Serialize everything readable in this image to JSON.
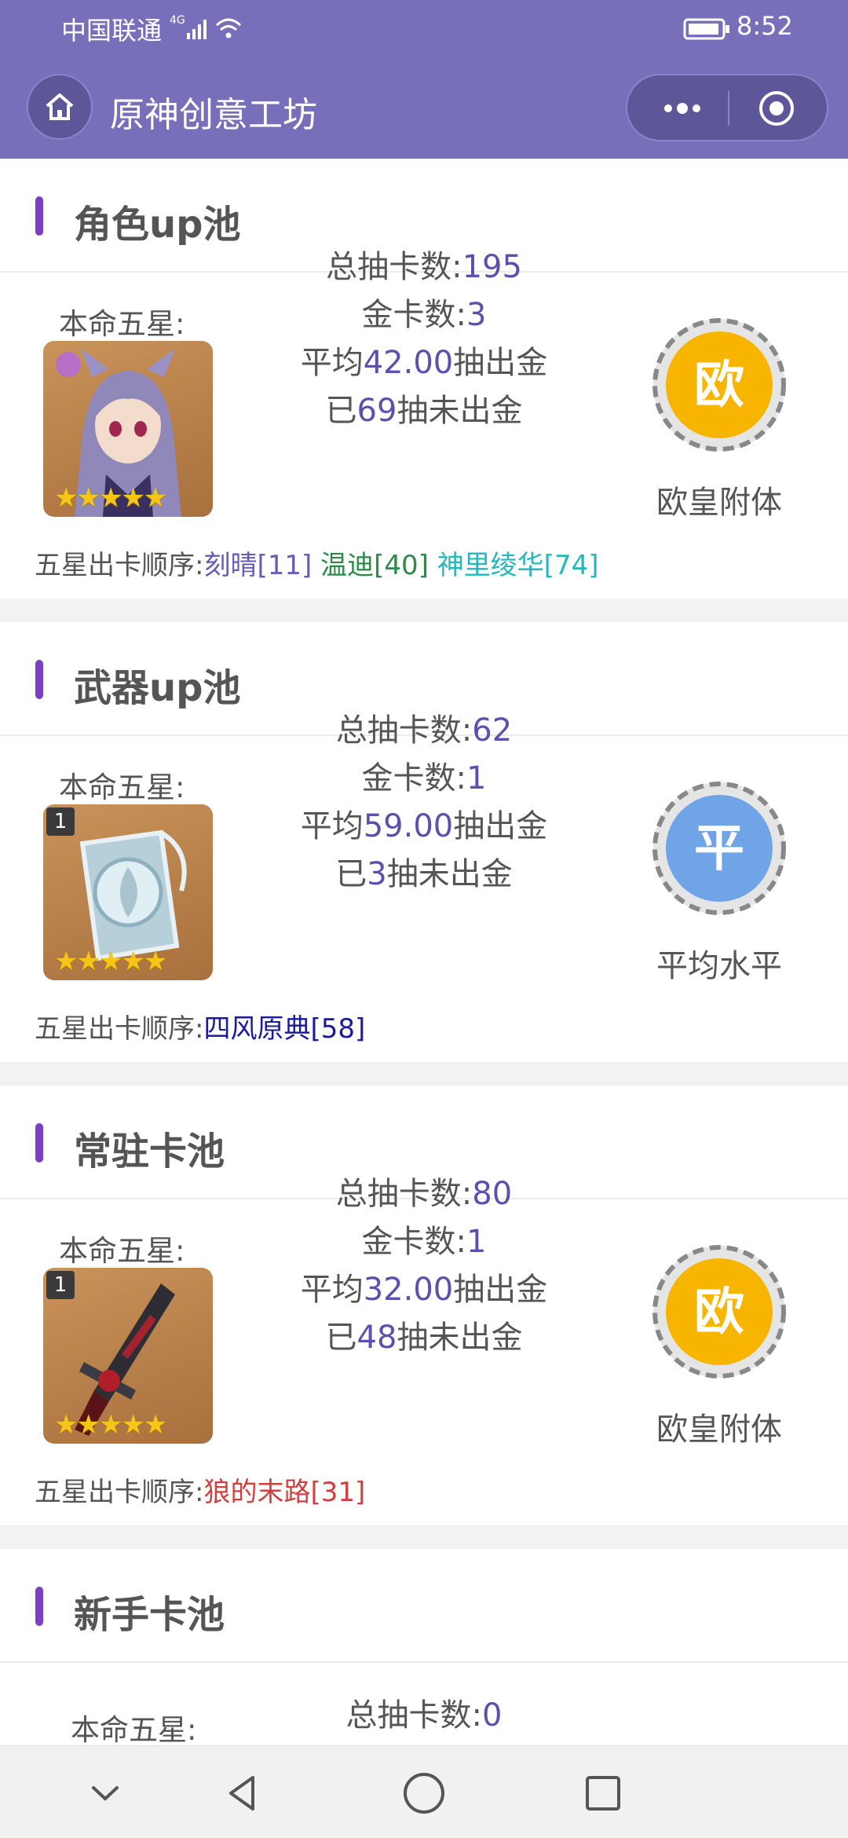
{
  "status_bar": {
    "carrier": "中国联通",
    "network": "4G",
    "time": "8:52"
  },
  "header": {
    "title": "原神创意工坊"
  },
  "common": {
    "main_label": "本命五星:",
    "order_label": "五星出卡顺序:"
  },
  "pools": [
    {
      "title": "角色up池",
      "total_label": "总抽卡数:",
      "total": "195",
      "gold_label": "金卡数:",
      "gold": "3",
      "avg_prefix": "平均",
      "avg": "42.00",
      "avg_suffix": "抽出金",
      "since_prefix": "已",
      "since": "69",
      "since_suffix": "抽未出金",
      "badge_char": "欧",
      "badge_label": "欧皇附体",
      "badge_color": "#f7b500",
      "order": [
        {
          "name": "刻晴[11]",
          "color": "#6a5ab8"
        },
        {
          "name": "温迪[40]",
          "color": "#2f8a4a"
        },
        {
          "name": "神里绫华[74]",
          "color": "#22b8bd"
        }
      ]
    },
    {
      "title": "武器up池",
      "total_label": "总抽卡数:",
      "total": "62",
      "gold_label": "金卡数:",
      "gold": "1",
      "avg_prefix": "平均",
      "avg": "59.00",
      "avg_suffix": "抽出金",
      "since_prefix": "已",
      "since": "3",
      "since_suffix": "抽未出金",
      "badge_char": "平",
      "badge_label": "平均水平",
      "badge_color": "#6fa4e6",
      "order": [
        {
          "name": "四风原典[58]",
          "color": "#1a1a9a"
        }
      ]
    },
    {
      "title": "常驻卡池",
      "total_label": "总抽卡数:",
      "total": "80",
      "gold_label": "金卡数:",
      "gold": "1",
      "avg_prefix": "平均",
      "avg": "32.00",
      "avg_suffix": "抽出金",
      "since_prefix": "已",
      "since": "48",
      "since_suffix": "抽未出金",
      "badge_char": "欧",
      "badge_label": "欧皇附体",
      "badge_color": "#f7b500",
      "order": [
        {
          "name": "狼的末路[31]",
          "color": "#d23f3f"
        }
      ]
    },
    {
      "title": "新手卡池",
      "total_label": "总抽卡数:",
      "total": "0"
    }
  ],
  "thumb_stars": "★★★★★",
  "weapon_rank": "1"
}
